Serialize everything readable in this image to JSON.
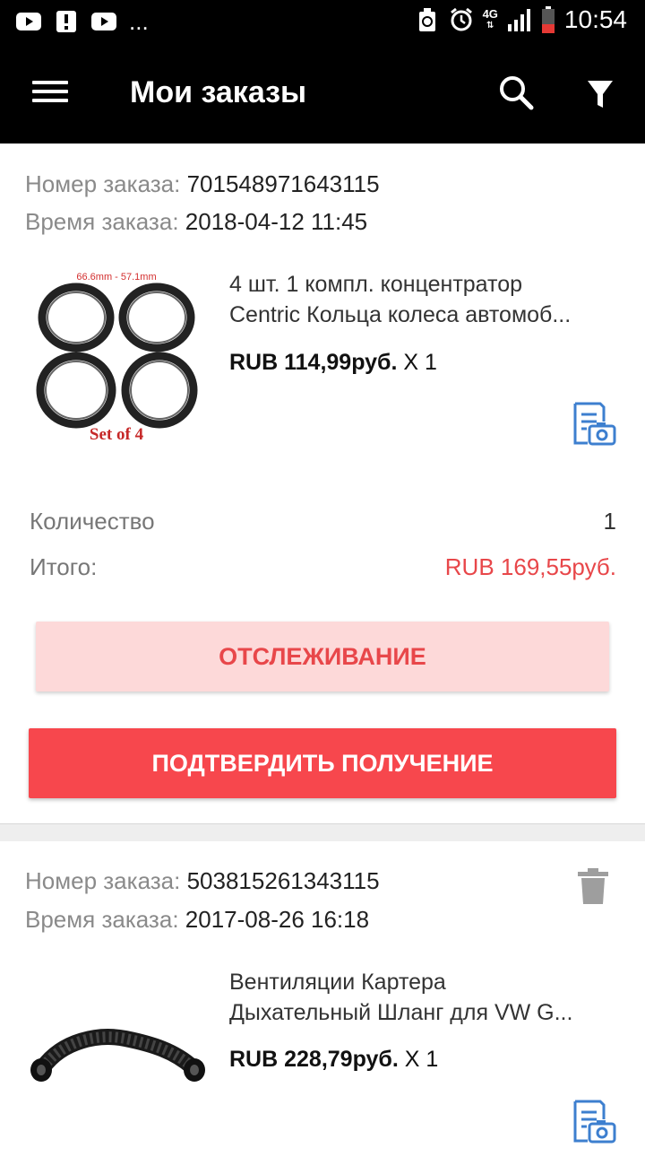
{
  "status_bar": {
    "time": "10:54",
    "network": "4G",
    "more": "..."
  },
  "app_bar": {
    "title": "Мои заказы"
  },
  "orders": [
    {
      "order_number_label": "Номер заказа:",
      "order_number": "701548971643115",
      "order_time_label": "Время заказа:",
      "order_time": "2018-04-12 11:45",
      "image_caption_top": "66.6mm - 57.1mm",
      "image_caption_bottom": "Set of 4",
      "title_line1": "4 шт. 1 компл. концентратор",
      "title_line2": "Centric Кольца колеса автомоб...",
      "price": "RUB 114,99руб.",
      "qty_mult": "X 1",
      "quantity_label": "Количество",
      "quantity": "1",
      "total_label": "Итого:",
      "total": "RUB 169,55руб.",
      "track_label": "ОТСЛЕЖИВАНИЕ",
      "confirm_label": "ПОДТВЕРДИТЬ ПОЛУЧЕНИЕ"
    },
    {
      "order_number_label": "Номер заказа:",
      "order_number": "503815261343115",
      "order_time_label": "Время заказа:",
      "order_time": "2017-08-26 16:18",
      "title_line1": "Вентиляции Картера",
      "title_line2": "Дыхательный Шланг для VW G...",
      "price": "RUB 228,79руб.",
      "qty_mult": "X 1"
    }
  ],
  "colors": {
    "accent_red": "#f7474d",
    "track_bg": "#fdd9d9",
    "total_red": "#e8474a",
    "icon_blue": "#3d7fcf"
  }
}
